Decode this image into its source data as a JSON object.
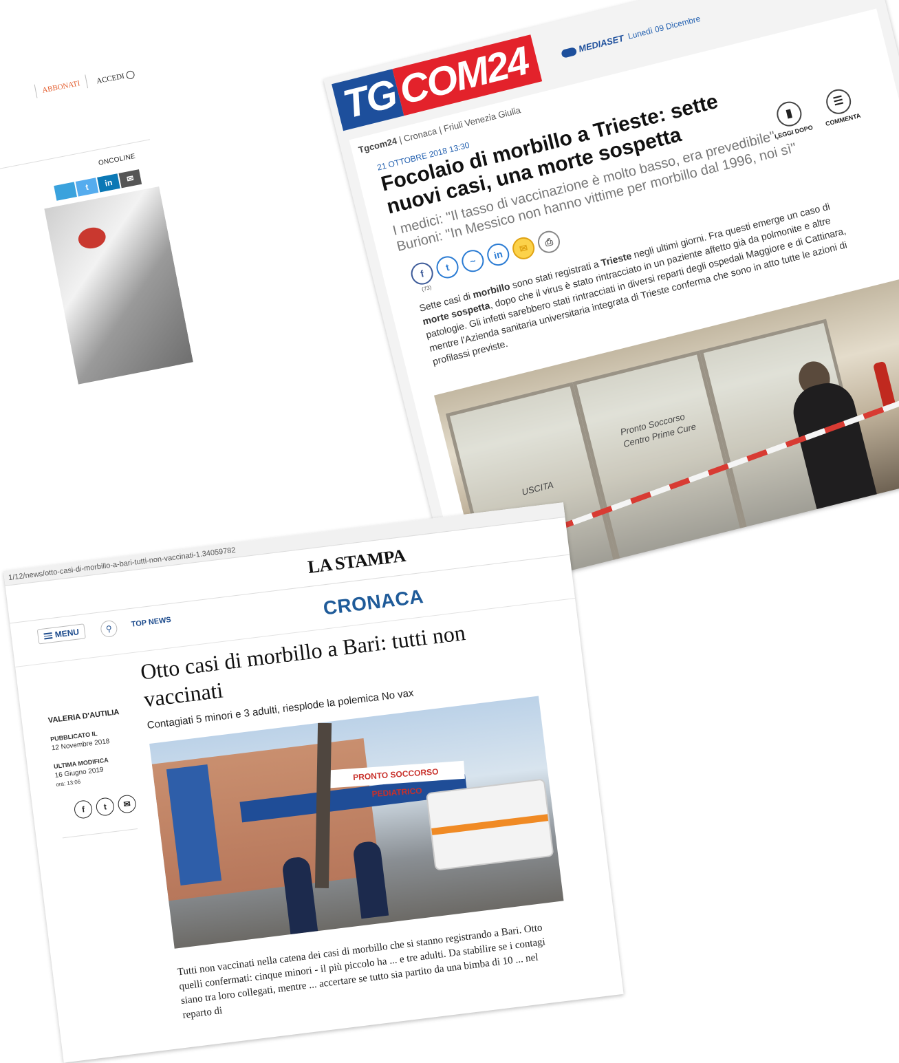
{
  "left_page": {
    "abbonati": "ABBONATI",
    "accedi": "ACCEDI",
    "oncoline": "ONCOLINE"
  },
  "tgcom": {
    "logo_tg": "TG",
    "logo_com": "COM24",
    "mediaset": "MEDIASET",
    "date": "Lunedì 09 Dicembre",
    "breadcrumb": {
      "site": "Tgcom24",
      "section": "Cronaca",
      "region": "Friuli Venezia Giulia"
    },
    "pubdate": "21 OTTOBRE 2018 13:30",
    "title": "Focolaio di morbillo a Trieste: sette nuovi casi, una morte sospetta",
    "subtitle": "I medici: \"Il tasso di vaccinazione è molto basso, era prevedibile\". Burioni: \"In Messico non hanno vittime per morbillo dal 1996, noi sì\"",
    "tool_leggi": "LEGGI DOPO",
    "tool_commenta": "COMMENTA",
    "share_count": "(73)",
    "body_p1": "Sette casi di ",
    "body_b1": "morbillo",
    "body_p2": " sono stati registrati a ",
    "body_b2": "Trieste",
    "body_p3": " negli ultimi giorni. Fra questi emerge un caso di ",
    "body_b3": "morte sospetta",
    "body_p4": ", dopo che il virus è stato rintracciato in un paziente affetto già da polmonite e altre patologie. Gli infetti sarebbero stati rintracciati in diversi reparti degli ospedali Maggiore e di Cattinara, mentre l'Azienda sanitaria universitaria integrata di Trieste conferma che sono in atto tutte le azioni di profilassi previste.",
    "photo_sign1": "Pronto Soccorso",
    "photo_sign2": "Centro Prime Cure",
    "photo_sign3": "USCITA",
    "accent_blue": "#1d4f9c",
    "accent_red": "#e3222b"
  },
  "lastampa": {
    "url": "1/12/news/otto-casi-di-morbillo-a-bari-tutti-non-vaccinati-1.34059782",
    "brand": "LA STAMPA",
    "menu": "MENU",
    "topnews": "TOP NEWS",
    "section": "CRONACA",
    "author": "VALERIA D'AUTILIA",
    "published_label": "PUBBLICATO IL",
    "published_date": "12 Novembre 2018",
    "modified_label": "ULTIMA MODIFICA",
    "modified_date": "16 Giugno 2019",
    "modified_time": "ora: 13:06",
    "title": "Otto casi di morbillo a Bari: tutti non vaccinati",
    "lede": "Contagiati 5 minori e 3 adulti, riesplode la polemica No vax",
    "photo_sign": "PRONTO SOCCORSO PEDIATRICO",
    "body": "Tutti non vaccinati nella catena dei casi di morbillo che si stanno registrando a Bari. Otto quelli confermati: cinque minori - il più piccolo ha ... e tre adulti. Da stabilire se i contagi siano tra loro collegati, mentre ... accertare se tutto sia partito da una bimba di 10 ... nel reparto di",
    "section_color": "#1f5b99"
  }
}
